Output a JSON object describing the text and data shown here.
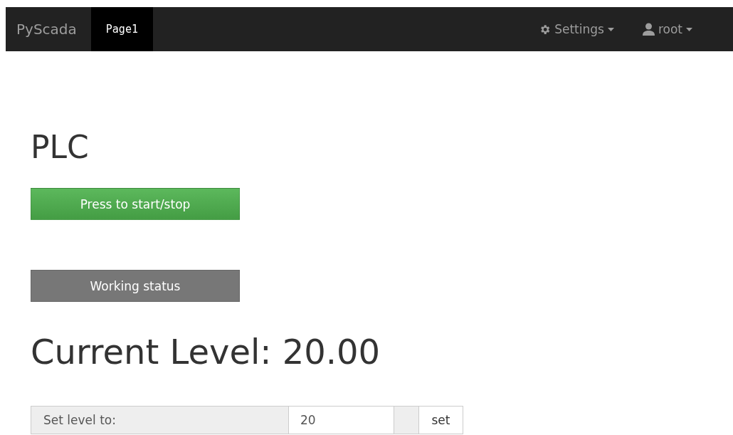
{
  "navbar": {
    "brand": "PyScada",
    "tabs": [
      {
        "label": "Page1",
        "selected": true
      }
    ],
    "menus": [
      {
        "kind": "settings",
        "label": "Settings"
      },
      {
        "kind": "user",
        "label": "root"
      }
    ]
  },
  "title": "PLC",
  "start_button": {
    "label": "Press to start/stop"
  },
  "status": {
    "label": "Working status",
    "on": false
  },
  "current_level": "Current Level: 20.00",
  "set_form": {
    "label": "Set level to:",
    "value": "20",
    "button": "set"
  }
}
